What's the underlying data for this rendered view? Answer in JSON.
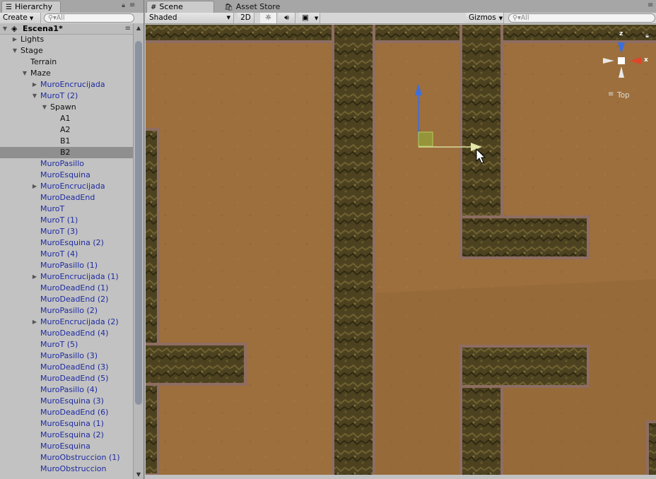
{
  "hierarchy": {
    "tab_label": "Hierarchy",
    "create_label": "Create",
    "search_placeholder": "All",
    "scene_name": "Escena1*",
    "items": [
      {
        "label": "Lights",
        "depth": 1,
        "arrow": "right",
        "style": "plain"
      },
      {
        "label": "Stage",
        "depth": 1,
        "arrow": "down",
        "style": "plain"
      },
      {
        "label": "Terrain",
        "depth": 2,
        "arrow": "",
        "style": "plain"
      },
      {
        "label": "Maze",
        "depth": 2,
        "arrow": "down",
        "style": "plain"
      },
      {
        "label": "MuroEncrucijada",
        "depth": 3,
        "arrow": "right",
        "style": "prefab"
      },
      {
        "label": "MuroT (2)",
        "depth": 3,
        "arrow": "down",
        "style": "prefab"
      },
      {
        "label": "Spawn",
        "depth": 4,
        "arrow": "down",
        "style": "plain"
      },
      {
        "label": "A1",
        "depth": 5,
        "arrow": "",
        "style": "plain"
      },
      {
        "label": "A2",
        "depth": 5,
        "arrow": "",
        "style": "plain"
      },
      {
        "label": "B1",
        "depth": 5,
        "arrow": "",
        "style": "plain"
      },
      {
        "label": "B2",
        "depth": 5,
        "arrow": "",
        "style": "plain",
        "selected": true
      },
      {
        "label": "MuroPasillo",
        "depth": 3,
        "arrow": "",
        "style": "prefab"
      },
      {
        "label": "MuroEsquina",
        "depth": 3,
        "arrow": "",
        "style": "prefab"
      },
      {
        "label": "MuroEncrucijada",
        "depth": 3,
        "arrow": "right",
        "style": "prefab"
      },
      {
        "label": "MuroDeadEnd",
        "depth": 3,
        "arrow": "",
        "style": "prefab"
      },
      {
        "label": "MuroT",
        "depth": 3,
        "arrow": "",
        "style": "prefab"
      },
      {
        "label": "MuroT (1)",
        "depth": 3,
        "arrow": "",
        "style": "prefab"
      },
      {
        "label": "MuroT (3)",
        "depth": 3,
        "arrow": "",
        "style": "prefab"
      },
      {
        "label": "MuroEsquina (2)",
        "depth": 3,
        "arrow": "",
        "style": "prefab"
      },
      {
        "label": "MuroT (4)",
        "depth": 3,
        "arrow": "",
        "style": "prefab"
      },
      {
        "label": "MuroPasillo (1)",
        "depth": 3,
        "arrow": "",
        "style": "prefab"
      },
      {
        "label": "MuroEncrucijada (1)",
        "depth": 3,
        "arrow": "right",
        "style": "prefab"
      },
      {
        "label": "MuroDeadEnd (1)",
        "depth": 3,
        "arrow": "",
        "style": "prefab"
      },
      {
        "label": "MuroDeadEnd (2)",
        "depth": 3,
        "arrow": "",
        "style": "prefab"
      },
      {
        "label": "MuroPasillo (2)",
        "depth": 3,
        "arrow": "",
        "style": "prefab"
      },
      {
        "label": "MuroEncrucijada (2)",
        "depth": 3,
        "arrow": "right",
        "style": "prefab"
      },
      {
        "label": "MuroDeadEnd (4)",
        "depth": 3,
        "arrow": "",
        "style": "prefab"
      },
      {
        "label": "MuroT (5)",
        "depth": 3,
        "arrow": "",
        "style": "prefab"
      },
      {
        "label": "MuroPasillo (3)",
        "depth": 3,
        "arrow": "",
        "style": "prefab"
      },
      {
        "label": "MuroDeadEnd (3)",
        "depth": 3,
        "arrow": "",
        "style": "prefab"
      },
      {
        "label": "MuroDeadEnd (5)",
        "depth": 3,
        "arrow": "",
        "style": "prefab"
      },
      {
        "label": "MuroPasillo (4)",
        "depth": 3,
        "arrow": "",
        "style": "prefab"
      },
      {
        "label": "MuroEsquina (3)",
        "depth": 3,
        "arrow": "",
        "style": "prefab"
      },
      {
        "label": "MuroDeadEnd (6)",
        "depth": 3,
        "arrow": "",
        "style": "prefab"
      },
      {
        "label": "MuroEsquina (1)",
        "depth": 3,
        "arrow": "",
        "style": "prefab"
      },
      {
        "label": "MuroEsquina (2)",
        "depth": 3,
        "arrow": "",
        "style": "prefab"
      },
      {
        "label": "MuroEsquina",
        "depth": 3,
        "arrow": "",
        "style": "prefab"
      },
      {
        "label": "MuroObstruccion (1)",
        "depth": 3,
        "arrow": "",
        "style": "prefab"
      },
      {
        "label": "MuroObstruccion",
        "depth": 3,
        "arrow": "",
        "style": "prefab"
      }
    ]
  },
  "scene": {
    "tab_label": "Scene",
    "asset_store_label": "Asset Store",
    "shading_mode": "Shaded",
    "mode_2d": "2D",
    "gizmos_label": "Gizmos",
    "search_placeholder": "All",
    "axis_y": "z",
    "axis_x": "x",
    "view_label": "Top"
  },
  "colors": {
    "ground": "#9b6e3c",
    "wall": "#4a3f1c",
    "wall_edge": "#8a6a5c",
    "prefab_text": "#1e2ba0",
    "gizmo_up": "#3b6fe0",
    "gizmo_right": "#d8dc9c",
    "gizmo_square": "#8fae3a",
    "axis_x_color": "#e0452c",
    "axis_z_color": "#3b6fe0"
  }
}
